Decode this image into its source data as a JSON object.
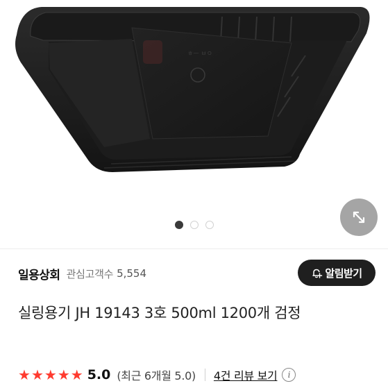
{
  "product": {
    "photo": {
      "subject": "black plastic sealing container tray",
      "icon": "tray-image"
    },
    "pager": {
      "total": 3,
      "active": 1
    },
    "expand_icon": "expand-arrows-icon",
    "title": "실링용기 JH 19143 3호 500ml 1200개 검정"
  },
  "shop": {
    "name": "일용상회",
    "followers_label": "관심고객수",
    "followers_count": "5,554",
    "notify_label": "알림받기",
    "notify_icon": "bell-plus-icon"
  },
  "rating": {
    "stars": 5,
    "score": "5.0",
    "recent": "(최근 6개월 5.0)",
    "reviews_link": "4건 리뷰 보기",
    "info_icon": "info-icon",
    "star_color": "#ff3b2f"
  }
}
